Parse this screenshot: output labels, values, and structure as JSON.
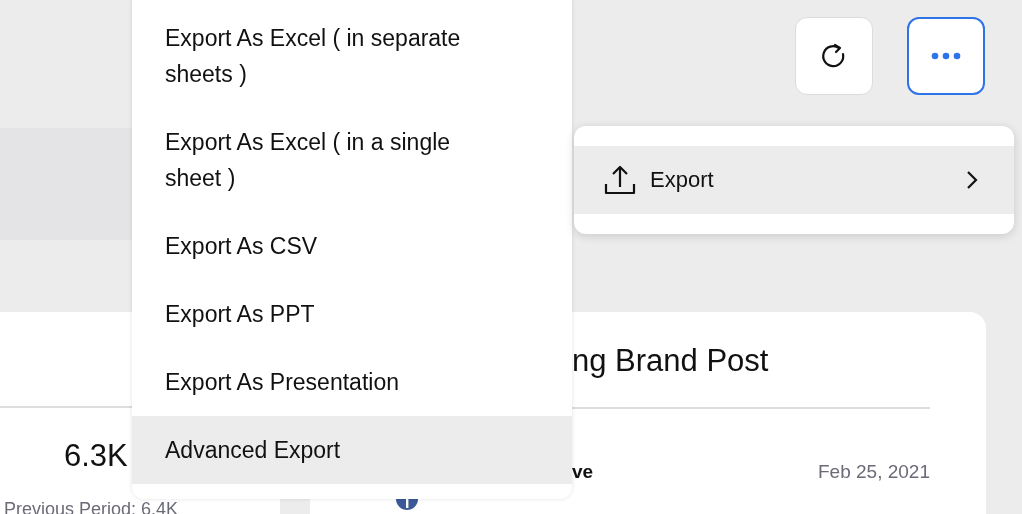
{
  "toolbar": {
    "buttons": [
      {
        "kind": "refresh",
        "selected": false
      },
      {
        "kind": "more",
        "selected": true
      }
    ]
  },
  "metric_card": {
    "value": "6.3K",
    "previous": "Previous Period: 6.4K"
  },
  "post_card": {
    "title": "ng Brand Post",
    "author": "ve",
    "date": "Feb 25, 2021"
  },
  "export_menu": {
    "items": [
      {
        "label": "Export As Excel ( in separate sheets )",
        "selected": false
      },
      {
        "label": "Export As Excel ( in a single sheet )",
        "selected": false
      },
      {
        "label": "Export As CSV",
        "selected": false
      },
      {
        "label": "Export As PPT",
        "selected": false
      },
      {
        "label": "Export As Presentation",
        "selected": false
      },
      {
        "label": "Advanced Export",
        "selected": true
      }
    ]
  },
  "actions_menu": {
    "items": [
      {
        "label": "Export",
        "selected": true
      }
    ]
  }
}
